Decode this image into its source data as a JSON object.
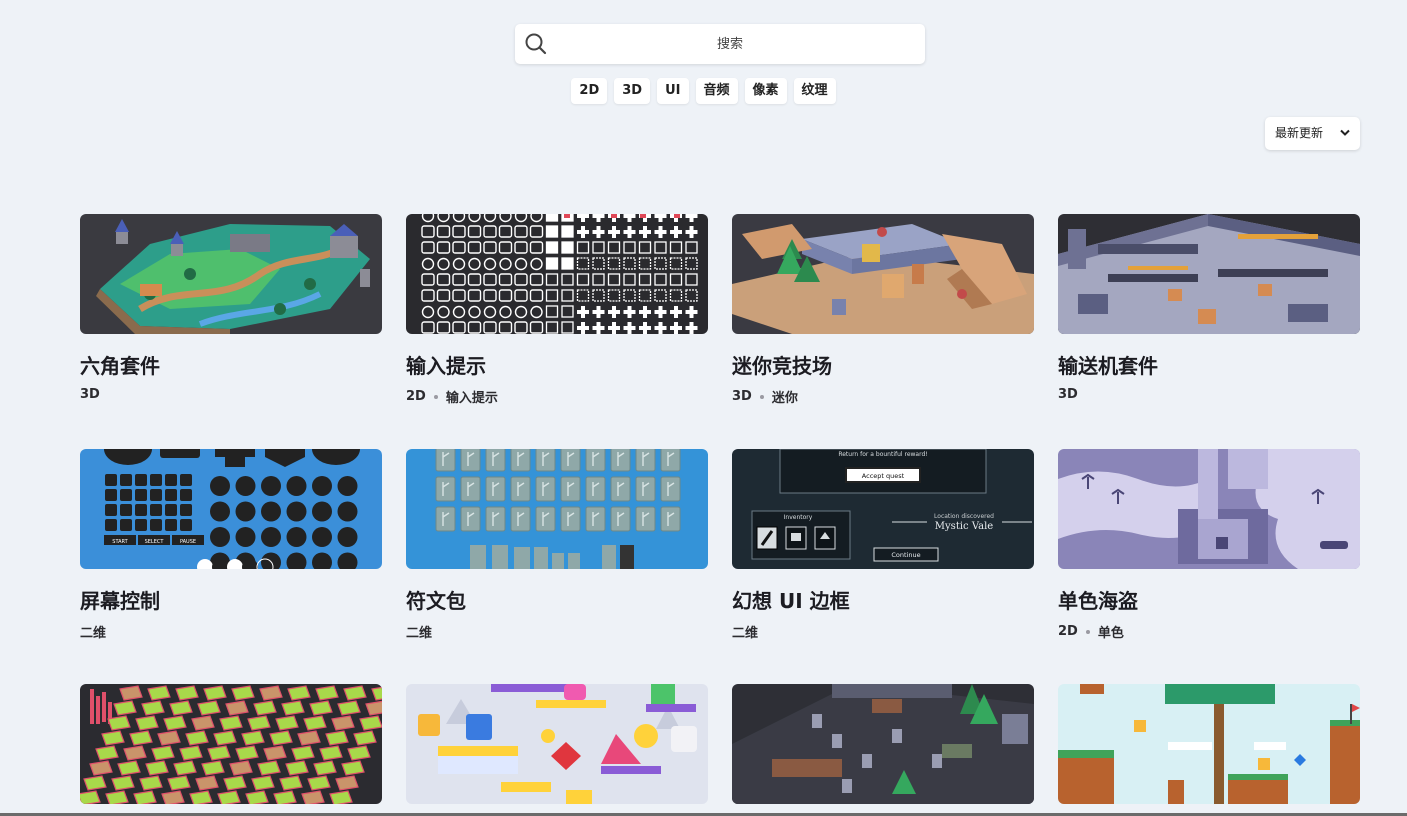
{
  "search": {
    "placeholder": "搜索",
    "icon": "search-icon"
  },
  "filters": [
    "2D",
    "3D",
    "UI",
    "音频",
    "像素",
    "纹理"
  ],
  "sort": {
    "label": "最新更新",
    "icon": "chevron-down-icon"
  },
  "cards": [
    {
      "title": "六角套件",
      "tags": [
        "3D"
      ]
    },
    {
      "title": "输入提示",
      "tags": [
        "2D",
        "输入提示"
      ]
    },
    {
      "title": "迷你竞技场",
      "tags": [
        "3D",
        "迷你"
      ]
    },
    {
      "title": "输送机套件",
      "tags": [
        "3D"
      ]
    },
    {
      "title": "屏幕控制",
      "tags": [
        "二维"
      ]
    },
    {
      "title": "符文包",
      "tags": [
        "二维"
      ]
    },
    {
      "title": "幻想 UI 边框",
      "tags": [
        "二维"
      ]
    },
    {
      "title": "单色海盗",
      "tags": [
        "2D",
        "单色"
      ]
    },
    {
      "title": "",
      "tags": []
    },
    {
      "title": "",
      "tags": []
    },
    {
      "title": "",
      "tags": []
    },
    {
      "title": "",
      "tags": []
    }
  ],
  "thumb_text": {
    "ui_quest": "Return for a bountiful reward!",
    "ui_accept": "Accept quest",
    "ui_inventory": "Inventory",
    "ui_location": "Location discovered",
    "ui_place": "Mystic Vale",
    "ui_continue": "Continue",
    "ctrl_start": "START",
    "ctrl_select": "SELECT",
    "ctrl_pause": "PAUSE"
  },
  "colors": {
    "background": "#eef2f7",
    "ctrl_blue": "#3b8fd9",
    "rune_blue": "#3493d8",
    "pirate_purple": "#8a85b8",
    "dark_thumb": "#2b2b30"
  }
}
